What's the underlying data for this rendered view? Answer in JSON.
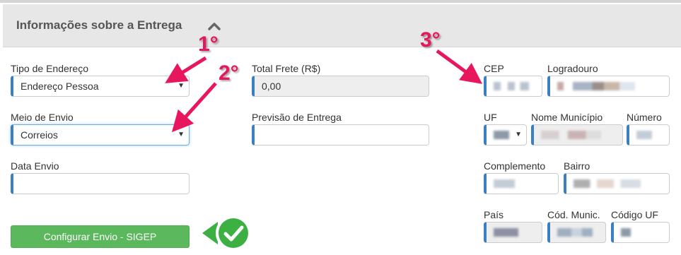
{
  "section": {
    "title": "Informações sobre a Entrega",
    "collapse_icon": "chevron-up-icon"
  },
  "annotations": {
    "first": "1°",
    "second": "2°",
    "third": "3°"
  },
  "form": {
    "tipo_endereco": {
      "label": "Tipo de Endereço",
      "value": "Endereço Pessoa"
    },
    "meio_envio": {
      "label": "Meio de Envio",
      "value": "Correios"
    },
    "data_envio": {
      "label": "Data Envio",
      "value": ""
    },
    "total_frete": {
      "label": "Total Frete (R$)",
      "value": "0,00"
    },
    "previsao_entrega": {
      "label": "Previsão de Entrega",
      "value": ""
    },
    "cep": {
      "label": "CEP"
    },
    "logradouro": {
      "label": "Logradouro"
    },
    "uf": {
      "label": "UF"
    },
    "nome_municipio": {
      "label": "Nome Município"
    },
    "numero": {
      "label": "Número"
    },
    "complemento": {
      "label": "Complemento"
    },
    "bairro": {
      "label": "Bairro"
    },
    "pais": {
      "label": "País"
    },
    "cod_munic": {
      "label": "Cód. Munic."
    },
    "codigo_uf": {
      "label": "Código UF"
    }
  },
  "button": {
    "label": "Configurar Envio - SIGEP",
    "check_icon": "check-circle-icon"
  },
  "colors": {
    "accent": "#3a7fc1",
    "button": "#5cb85c",
    "annotation": "#e8175d",
    "badge": "#3cb043"
  }
}
